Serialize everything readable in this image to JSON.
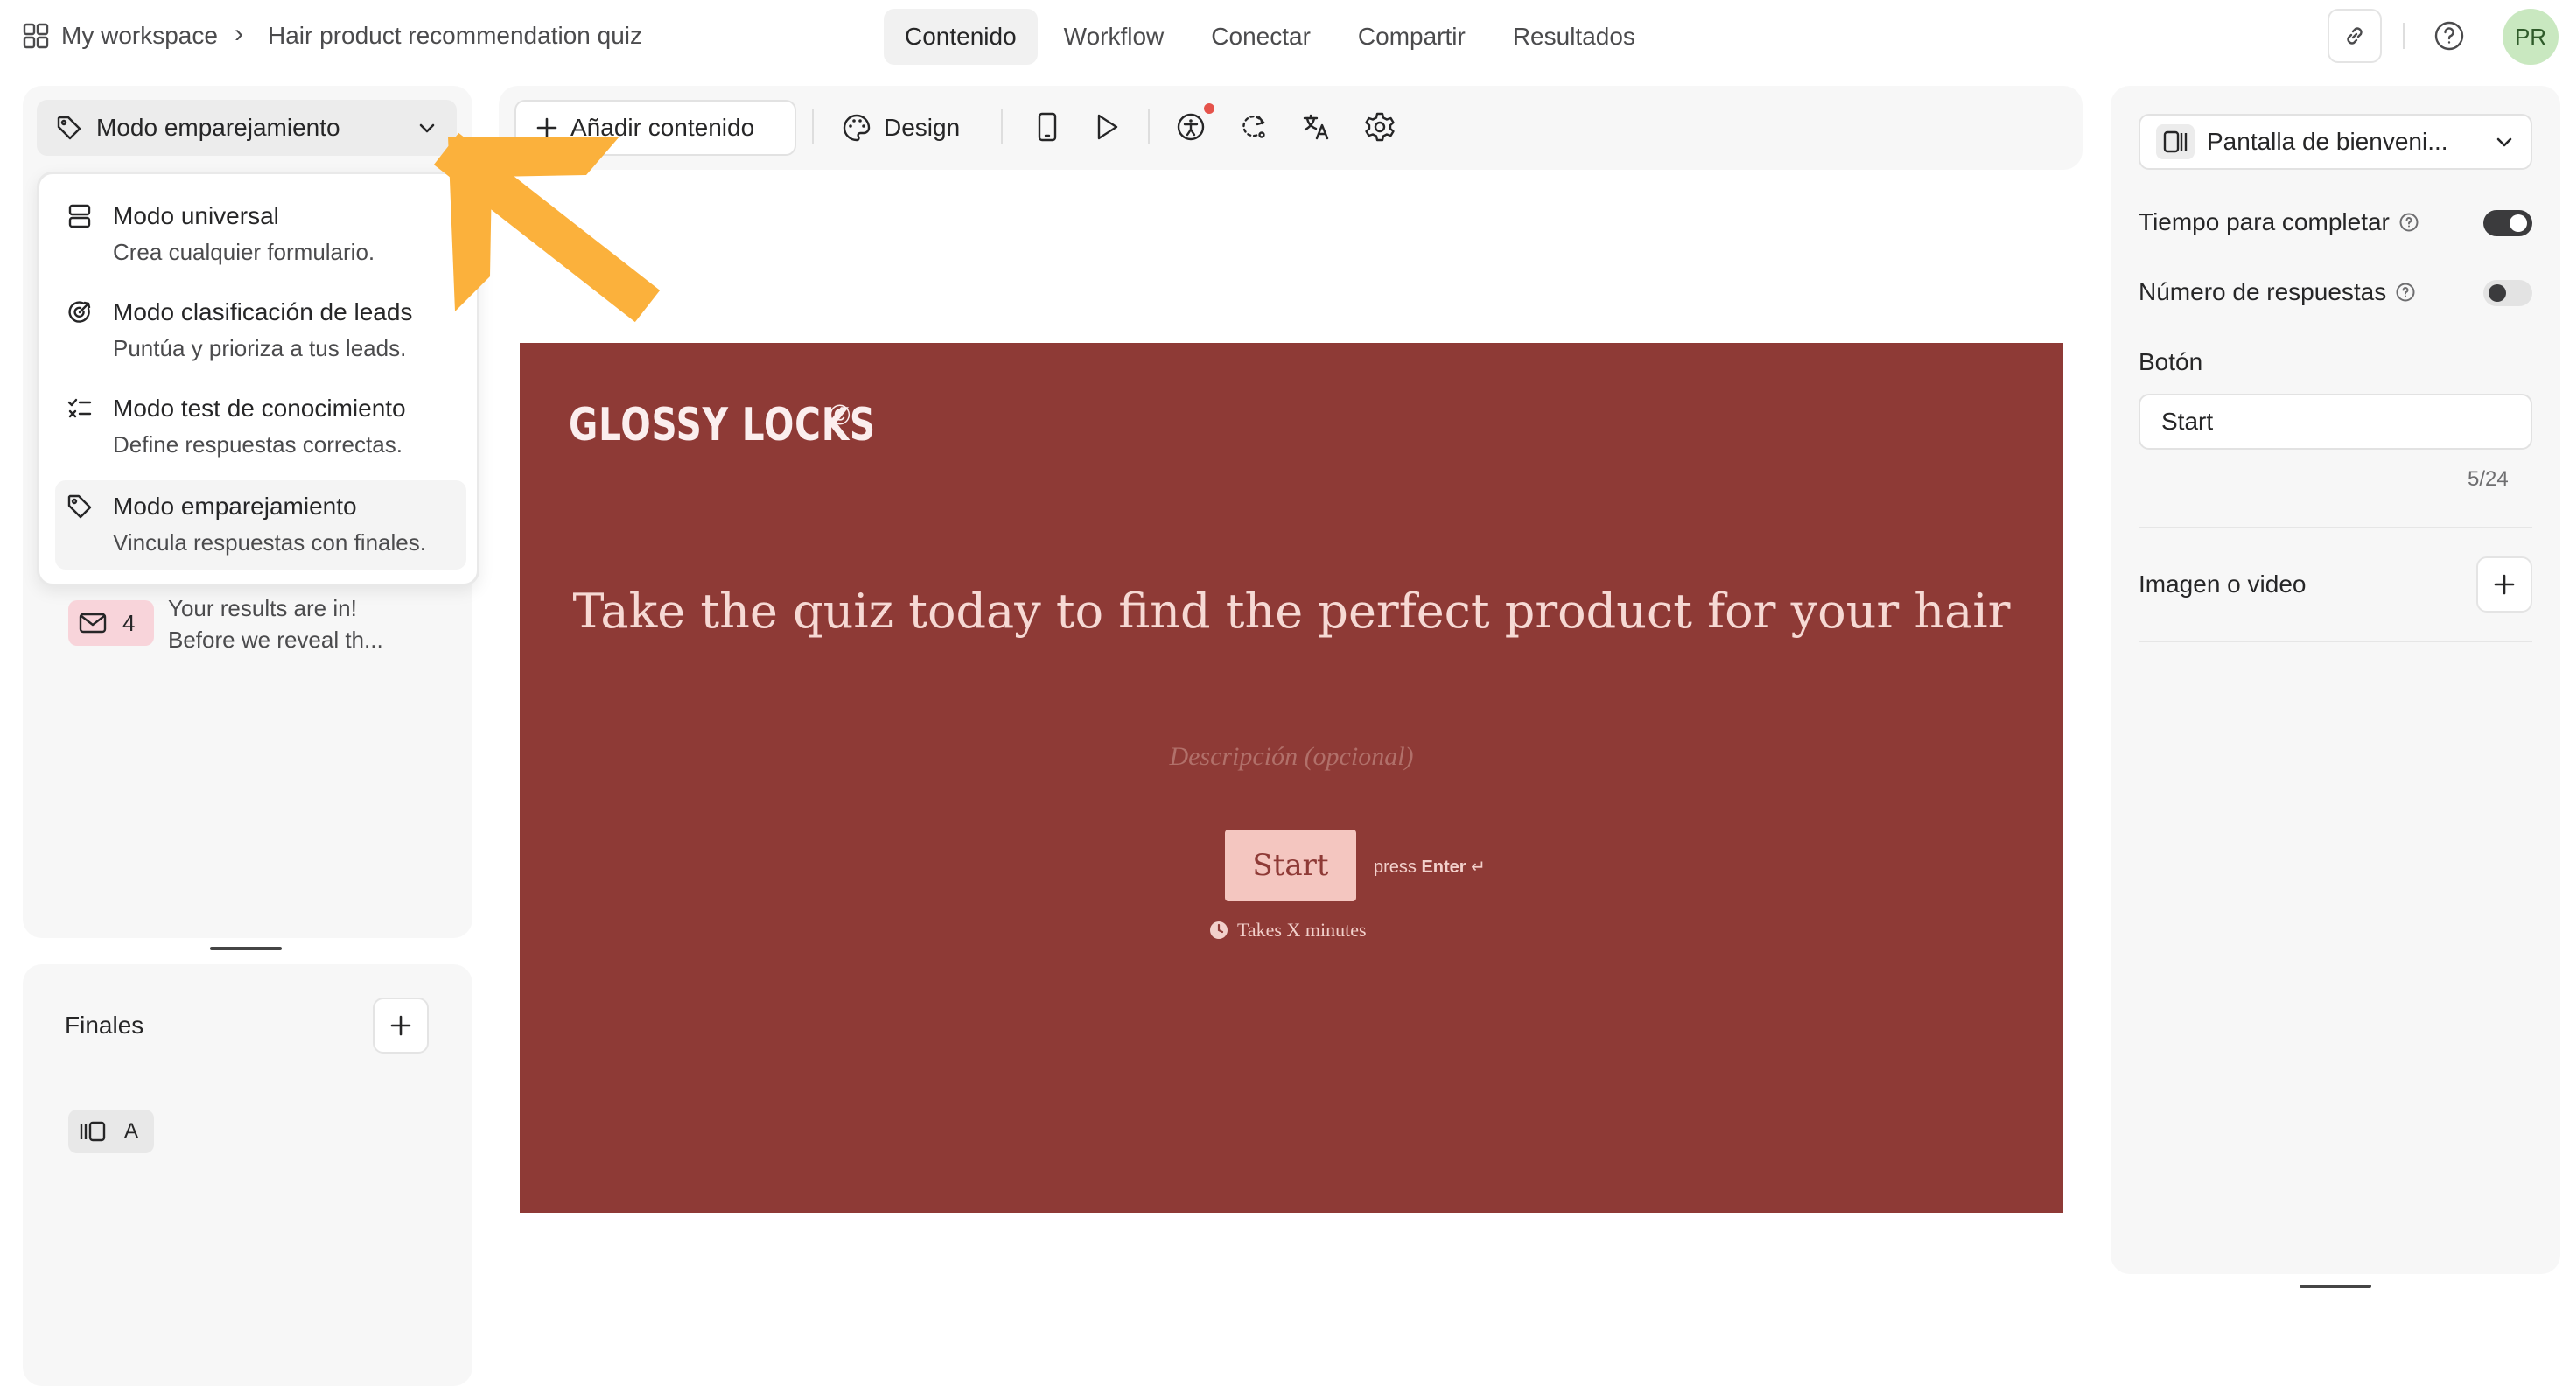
{
  "breadcrumb": {
    "workspace": "My workspace",
    "separator": "›",
    "form_name": "Hair product recommendation quiz"
  },
  "tabs": [
    {
      "label": "Contenido",
      "active": true
    },
    {
      "label": "Workflow",
      "active": false
    },
    {
      "label": "Conectar",
      "active": false
    },
    {
      "label": "Compartir",
      "active": false
    },
    {
      "label": "Resultados",
      "active": false
    }
  ],
  "user": {
    "initials": "PR",
    "avatar_color": "#c9e8c0"
  },
  "mode_selector": {
    "current": "Modo emparejamiento",
    "options": [
      {
        "title": "Modo universal",
        "subtitle": "Crea cualquier formulario.",
        "icon": "stacked-rows-icon"
      },
      {
        "title": "Modo clasificación de leads",
        "subtitle": "Puntúa y prioriza a tus leads.",
        "icon": "target-icon"
      },
      {
        "title": "Modo test de conocimiento",
        "subtitle": "Define respuestas correctas.",
        "icon": "checklist-icon"
      },
      {
        "title": "Modo emparejamiento",
        "subtitle": "Vincula respuestas con finales.",
        "icon": "tag-icon",
        "selected": true
      }
    ]
  },
  "questions": [
    {
      "number": "4",
      "title": "Your results are in!",
      "subtitle": "Before we reveal th...",
      "icon": "mail-icon",
      "badge_color": "#f8d4da"
    }
  ],
  "endings": {
    "title": "Finales",
    "items": [
      {
        "label": "A",
        "icon": "ending-screen-icon"
      }
    ]
  },
  "toolbar": {
    "add_content": "Añadir contenido",
    "design": "Design"
  },
  "canvas": {
    "background_color": "#8e3a36",
    "brand": "GLOSSY LOCKS",
    "brand_mark": "©",
    "headline": "Take the quiz today to find the perfect product for your hair",
    "description_placeholder": "Descripción (opcional)",
    "button_label": "Start",
    "press_prefix": "press",
    "press_key": "Enter",
    "press_symbol": "↵",
    "time_hint": "Takes X minutes"
  },
  "settings": {
    "screen_type": "Pantalla de bienveni...",
    "time_to_complete": {
      "label": "Tiempo para completar",
      "enabled": true
    },
    "response_count": {
      "label": "Número de respuestas",
      "enabled": false
    },
    "button": {
      "label": "Botón",
      "value": "Start",
      "counter": "5/24"
    },
    "media": {
      "label": "Imagen o video"
    }
  },
  "annotation": {
    "arrow_color": "#fbb13c"
  }
}
